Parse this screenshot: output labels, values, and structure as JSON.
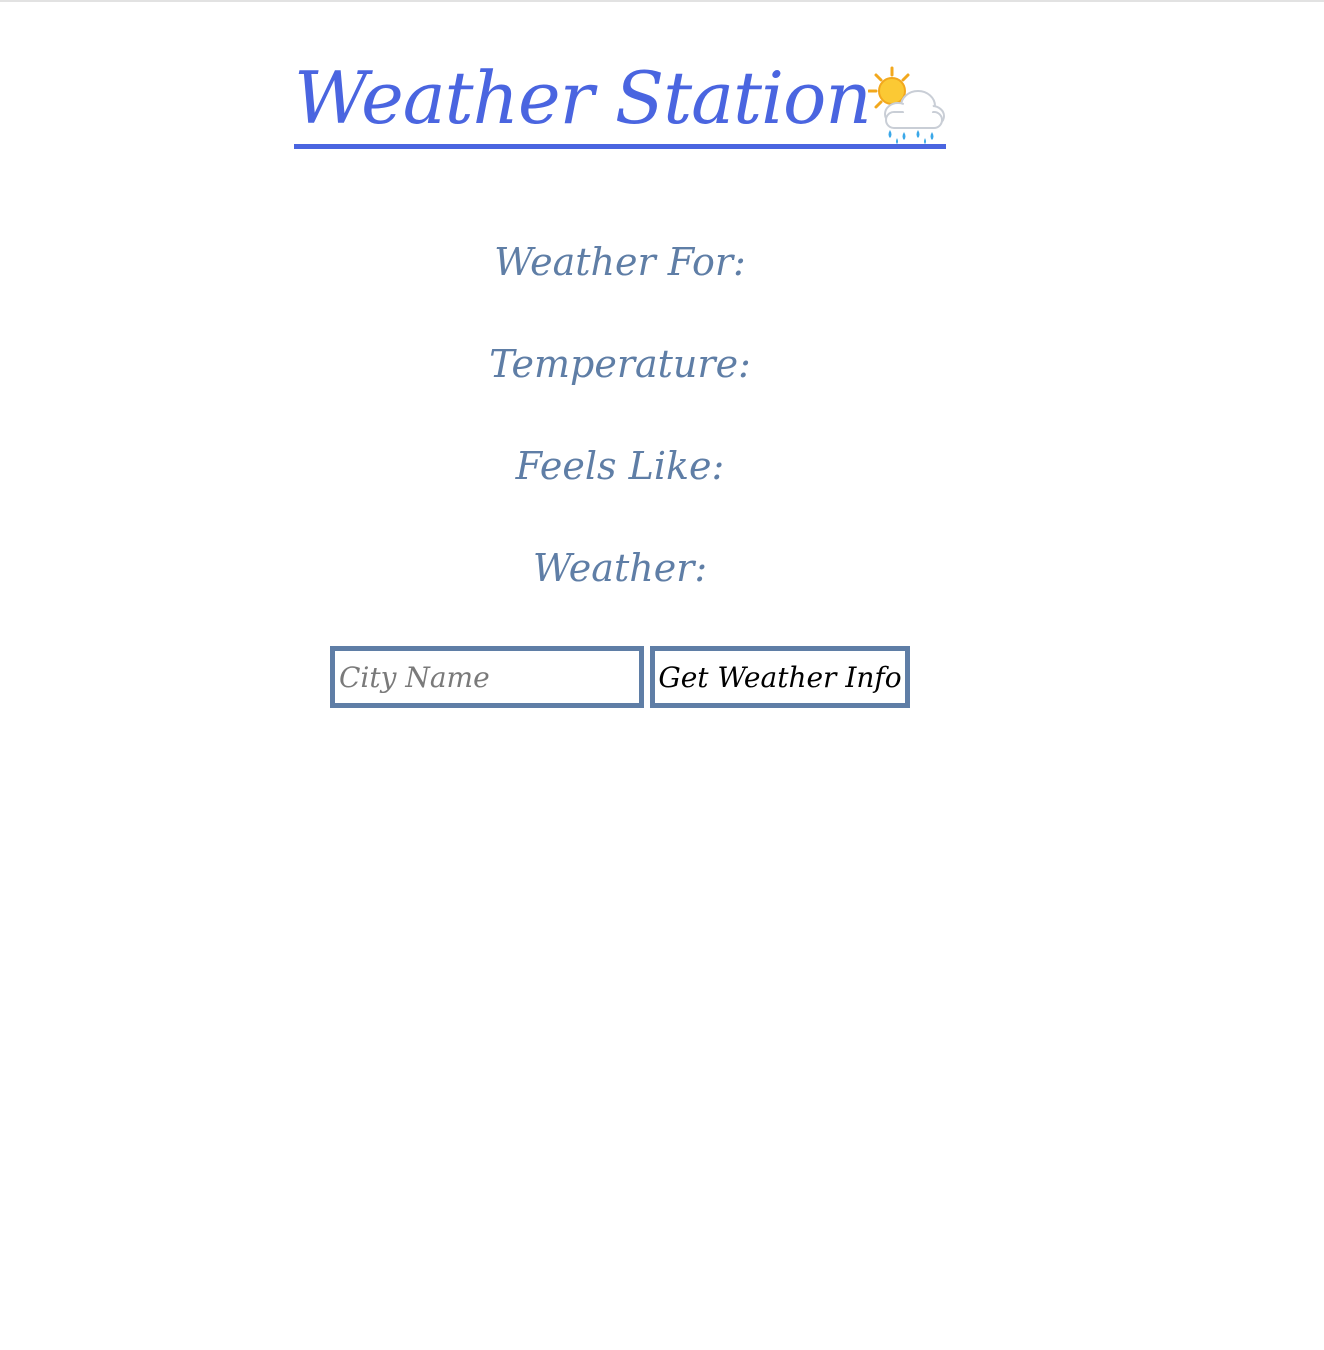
{
  "header": {
    "title": "Weather Station",
    "title_icon": "sun-behind-rain-cloud-icon",
    "title_color": "#4a65e0"
  },
  "info": {
    "weather_for_label": "Weather For:",
    "temperature_label": "Temperature:",
    "feels_like_label": "Feels Like:",
    "weather_label": "Weather:",
    "label_color": "#5f7ea6"
  },
  "form": {
    "city_placeholder": "City Name",
    "city_value": "",
    "submit_label": "Get Weather Info",
    "border_color": "#5f7ea6"
  }
}
